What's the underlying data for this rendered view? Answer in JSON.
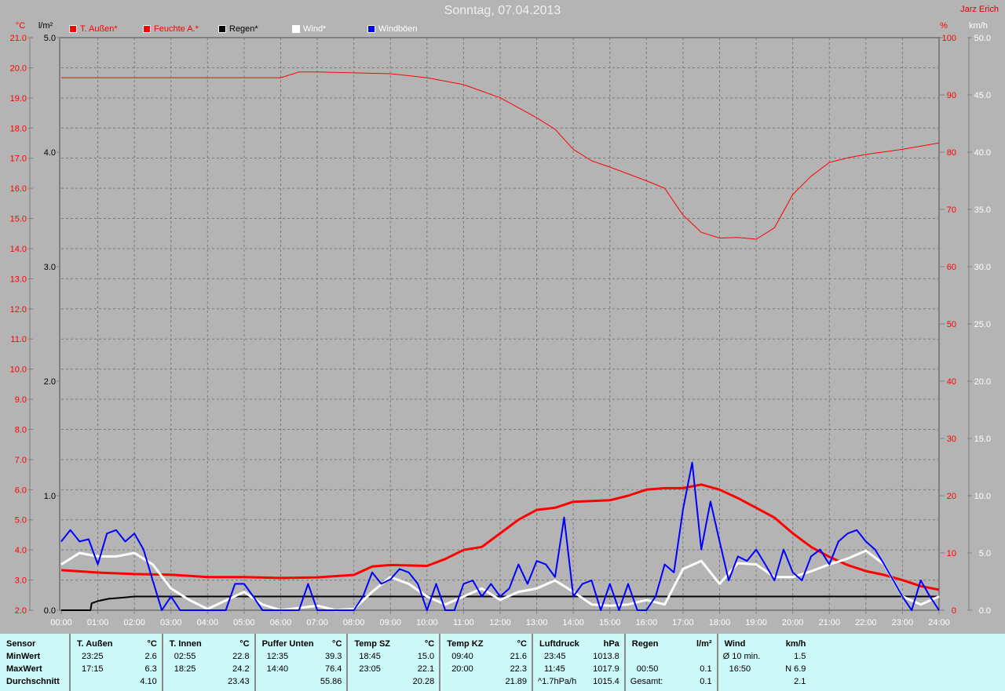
{
  "title": "Sonntag, 07.04.2013",
  "author": "Jarz Erich",
  "legend": [
    {
      "label": "T. Außen*",
      "color": "#ff0000"
    },
    {
      "label": "Feuchte A.*",
      "color": "#ff0000"
    },
    {
      "label": "Regen*",
      "color": "#000000"
    },
    {
      "label": "Wind*",
      "color": "#ffffff"
    },
    {
      "label": "Windböen",
      "color": "#0000ff"
    }
  ],
  "chart_data": {
    "type": "line",
    "axes": {
      "temp": {
        "unit": "°C",
        "range": [
          2.0,
          21.0
        ],
        "step": 1.0,
        "color": "#ff0000"
      },
      "rain": {
        "unit": "l/m²",
        "range": [
          0.0,
          5.0
        ],
        "step": 1.0,
        "color": "#000000"
      },
      "humidity": {
        "unit": "%",
        "range": [
          0,
          100
        ],
        "step": 10,
        "color": "#ff0000"
      },
      "wind": {
        "unit": "km/h",
        "range": [
          0.0,
          50.0
        ],
        "step": 5.0,
        "color": "#ffffff"
      }
    },
    "x_ticks": [
      "00:00",
      "01:00",
      "02:00",
      "03:00",
      "04:00",
      "05:00",
      "06:00",
      "07:00",
      "08:00",
      "09:00",
      "10:00",
      "11:00",
      "12:00",
      "13:00",
      "14:00",
      "15:00",
      "16:00",
      "17:00",
      "18:00",
      "19:00",
      "20:00",
      "21:00",
      "22:00",
      "23:00",
      "24:00"
    ],
    "series": [
      {
        "name": "Feuchte A.",
        "axis": "humidity",
        "color": "#ff0000",
        "width": 1,
        "x": [
          0,
          6,
          6.5,
          7,
          9,
          10,
          11,
          12,
          13,
          13.5,
          14,
          14.5,
          15,
          16,
          16.5,
          17,
          17.5,
          18,
          18.5,
          19,
          19.5,
          20,
          20.5,
          21,
          21.5,
          22,
          23,
          24
        ],
        "y": [
          93,
          93,
          94,
          94,
          93.7,
          93,
          91.8,
          89.5,
          86,
          84,
          80.5,
          78.5,
          77.4,
          75,
          73.7,
          69,
          66,
          65,
          65.1,
          64.8,
          66.8,
          72.6,
          75.8,
          78.2,
          79,
          79.6,
          80.5,
          81.6
        ]
      },
      {
        "name": "T. Außen",
        "axis": "temp",
        "color": "#ff0000",
        "width": 3,
        "x": [
          0,
          1,
          2,
          3,
          4,
          5,
          6,
          7,
          8,
          8.5,
          9,
          10,
          10.5,
          11,
          11.5,
          12,
          12.5,
          13,
          13.5,
          14,
          15,
          15.5,
          16,
          16.5,
          17,
          17.5,
          18,
          18.5,
          19,
          19.5,
          20,
          20.5,
          21,
          21.5,
          22,
          22.5,
          23,
          23.5,
          24
        ],
        "y": [
          3.33,
          3.25,
          3.2,
          3.18,
          3.1,
          3.1,
          3.07,
          3.09,
          3.17,
          3.45,
          3.5,
          3.47,
          3.7,
          4.0,
          4.1,
          4.55,
          5.0,
          5.33,
          5.4,
          5.6,
          5.65,
          5.8,
          6.0,
          6.05,
          6.05,
          6.17,
          6.0,
          5.72,
          5.4,
          5.07,
          4.55,
          4.1,
          3.77,
          3.5,
          3.3,
          3.17,
          3.0,
          2.8,
          2.68
        ]
      },
      {
        "name": "Regen",
        "axis": "rain",
        "color": "#000000",
        "width": 2,
        "x": [
          0,
          0.8,
          0.83,
          1.0,
          1.3,
          1.7,
          2.0,
          24
        ],
        "y": [
          0,
          0,
          0.06,
          0.08,
          0.1,
          0.11,
          0.12,
          0.12
        ]
      },
      {
        "name": "Wind",
        "axis": "wind",
        "color": "#ffffff",
        "width": 3,
        "x": [
          0,
          0.5,
          1,
          1.5,
          2,
          2.5,
          3,
          3.5,
          4,
          5,
          5.5,
          6,
          7,
          7.5,
          8,
          8.5,
          9,
          9.5,
          10,
          10.5,
          11,
          11.5,
          12,
          12.5,
          13,
          13.5,
          14,
          14.5,
          15,
          15.5,
          16,
          16.5,
          17,
          17.5,
          18,
          18.5,
          19,
          19.5,
          20,
          20.5,
          21,
          21.5,
          22,
          22.5,
          23,
          23.5,
          24
        ],
        "y": [
          4.0,
          5.0,
          4.7,
          4.7,
          5.0,
          4.0,
          1.9,
          0.9,
          0.1,
          1.6,
          0.5,
          0,
          0.4,
          0,
          0.1,
          1.6,
          2.9,
          2.3,
          1.2,
          0.5,
          1.2,
          1.9,
          0.9,
          1.6,
          1.9,
          2.6,
          1.6,
          0.5,
          0.4,
          0.5,
          0.9,
          0.5,
          3.6,
          4.3,
          2.3,
          4.1,
          4.0,
          2.9,
          2.9,
          3.4,
          4.0,
          4.5,
          5.2,
          4.0,
          1.2,
          0.5,
          1.2
        ]
      },
      {
        "name": "Windböen",
        "axis": "wind",
        "color": "#0000ff",
        "width": 2,
        "interval_h": 0.25,
        "y": [
          6.0,
          7.0,
          6.0,
          6.2,
          4.0,
          6.7,
          7.0,
          6.0,
          6.7,
          5.3,
          2.6,
          0,
          1.2,
          0,
          0,
          0,
          0,
          0,
          0,
          2.3,
          2.3,
          1.2,
          0,
          0,
          0,
          0,
          0,
          2.3,
          0,
          0,
          0,
          0,
          0,
          1.2,
          3.3,
          2.3,
          2.7,
          3.6,
          3.3,
          2.3,
          0,
          2.3,
          0,
          0,
          2.3,
          2.6,
          1.2,
          2.3,
          1.2,
          1.9,
          4.0,
          2.3,
          4.3,
          4.0,
          2.9,
          8.1,
          1.2,
          2.3,
          2.6,
          0,
          2.3,
          0,
          2.3,
          0,
          0,
          1.2,
          4.0,
          3.3,
          8.8,
          12.9,
          5.3,
          9.5,
          6.0,
          2.6,
          4.7,
          4.3,
          5.3,
          4.0,
          2.6,
          5.3,
          3.3,
          2.6,
          4.7,
          5.3,
          4.0,
          6.0,
          6.7,
          7.0,
          6.0,
          5.3,
          4.0,
          2.6,
          1.2,
          0,
          2.6,
          1.2,
          0
        ]
      }
    ]
  },
  "table": {
    "row_labels": [
      "Sensor",
      "MinWert",
      "MaxWert",
      "Durchschnitt"
    ],
    "columns": [
      {
        "name": "T. Außen",
        "unit": "°C",
        "rows": [
          [
            "23:25",
            "2.6"
          ],
          [
            "17:15",
            "6.3"
          ],
          [
            "",
            "4.10"
          ]
        ]
      },
      {
        "name": "T. Innen",
        "unit": "°C",
        "rows": [
          [
            "02:55",
            "22.8"
          ],
          [
            "18:25",
            "24.2"
          ],
          [
            "",
            "23.43"
          ]
        ]
      },
      {
        "name": "Puffer Unten",
        "unit": "°C",
        "rows": [
          [
            "12:35",
            "39.3"
          ],
          [
            "14:40",
            "76.4"
          ],
          [
            "",
            "55.86"
          ]
        ]
      },
      {
        "name": "Temp SZ",
        "unit": "°C",
        "rows": [
          [
            "18:45",
            "15.0"
          ],
          [
            "23:05",
            "22.1"
          ],
          [
            "",
            "20.28"
          ]
        ]
      },
      {
        "name": "Temp KZ",
        "unit": "°C",
        "rows": [
          [
            "09:40",
            "21.6"
          ],
          [
            "20:00",
            "22.3"
          ],
          [
            "",
            "21.89"
          ]
        ]
      },
      {
        "name": "Luftdruck",
        "unit": "hPa",
        "rows": [
          [
            "23:45",
            "1013.8"
          ],
          [
            "11:45",
            "1017.9"
          ],
          [
            "^1.7hPa/h",
            "1015.4"
          ]
        ]
      },
      {
        "name": "Regen",
        "unit": "l/m²",
        "rows": [
          [
            "",
            ""
          ],
          [
            "00:50",
            "0.1"
          ],
          [
            "Gesamt:",
            "0.1"
          ]
        ]
      },
      {
        "name": "Wind",
        "unit": "km/h",
        "rows": [
          [
            "Ø 10 min.",
            "1.5"
          ],
          [
            "16:50",
            "N 6.9"
          ],
          [
            "",
            "2.1"
          ]
        ]
      }
    ]
  }
}
